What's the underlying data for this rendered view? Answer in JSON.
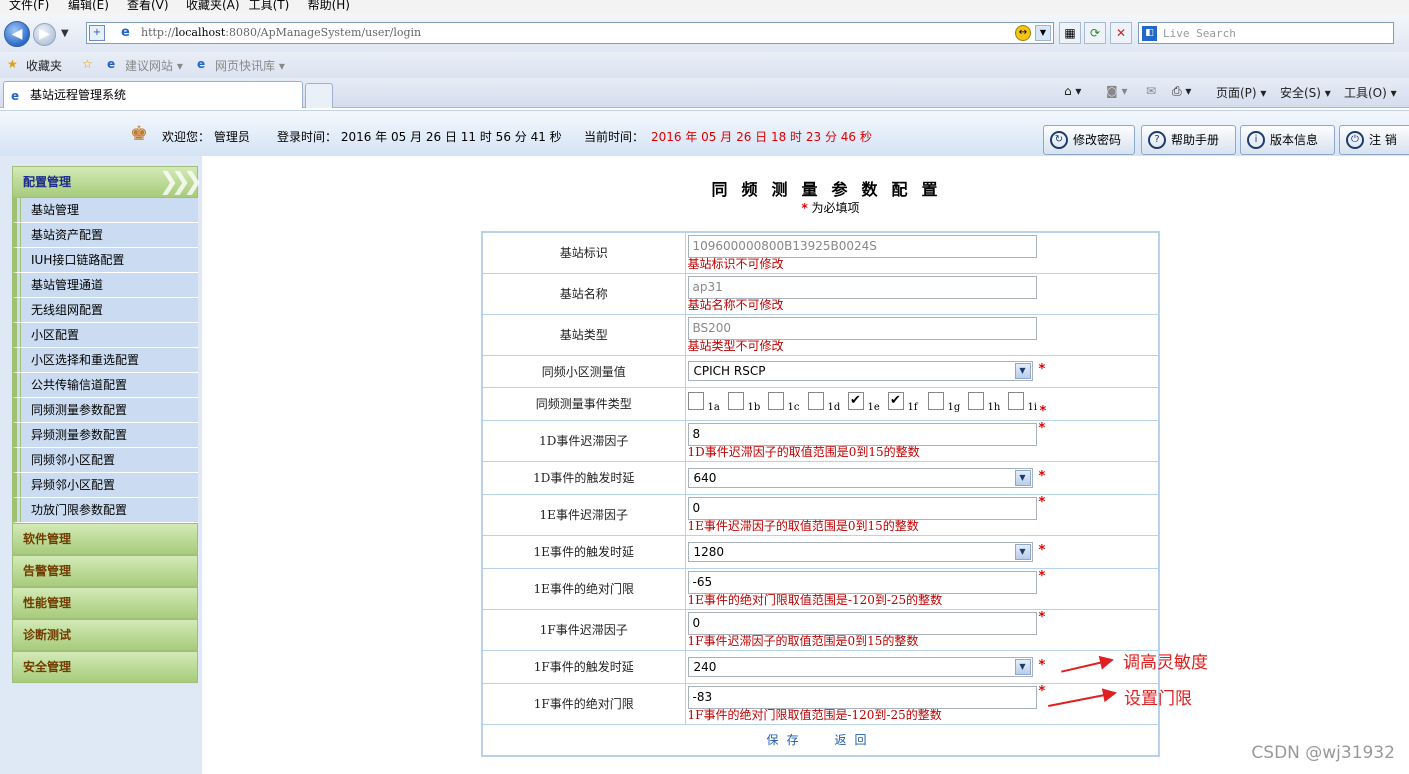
{
  "menu": [
    "文件(F)",
    "编辑(E)",
    "查看(V)",
    "收藏夹(A)",
    "工具(T)",
    "帮助(H)"
  ],
  "address": {
    "prefix": "http://",
    "host": "localhost",
    "rest": ":8080/ApManageSystem/user/login"
  },
  "search": {
    "placeholder": "Live Search"
  },
  "favorites": {
    "label": "收藏夹",
    "suggested": "建议网站 ▾",
    "slices": "网页快讯库 ▾"
  },
  "tab": {
    "title": "基站远程管理系统"
  },
  "commandbar": {
    "page": "页面(P) ▾",
    "safety": "安全(S) ▾",
    "tools": "工具(O) ▾"
  },
  "header": {
    "welcome": "欢迎您： 管理员",
    "login_time": "登录时间： 2016 年 05 月 26 日 11 时 56 分 41 秒",
    "current_label": "当前时间：",
    "current_time": "2016 年 05 月 26 日 18 时 23 分 46 秒",
    "buttons": [
      "修改密码",
      "帮助手册",
      "版本信息",
      "注 销"
    ]
  },
  "sidebar": {
    "active": "配置管理",
    "items": [
      "基站管理",
      "基站资产配置",
      "IUH接口链路配置",
      "基站管理通道",
      "无线组网配置",
      "小区配置",
      "小区选择和重选配置",
      "公共传输信道配置",
      "同频测量参数配置",
      "异频测量参数配置",
      "同频邻小区配置",
      "异频邻小区配置",
      "功放门限参数配置"
    ],
    "sections": [
      "软件管理",
      "告警管理",
      "性能管理",
      "诊断测试",
      "安全管理"
    ]
  },
  "page": {
    "title": "同频测量参数配置",
    "required_star": "*",
    "required_note": "为必填项"
  },
  "form": {
    "bs_id": {
      "label": "基站标识",
      "value": "109600000800B13925B0024S",
      "hint": "基站标识不可修改"
    },
    "bs_name": {
      "label": "基站名称",
      "value": "ap31",
      "hint": "基站名称不可修改"
    },
    "bs_type": {
      "label": "基站类型",
      "value": "BS200",
      "hint": "基站类型不可修改"
    },
    "meas_qty": {
      "label": "同频小区测量值",
      "value": "CPICH RSCP"
    },
    "event_types": {
      "label": "同频测量事件类型",
      "options": [
        "1a",
        "1b",
        "1c",
        "1d",
        "1e",
        "1f",
        "1g",
        "1h",
        "1i"
      ],
      "checked": [
        false,
        false,
        false,
        false,
        true,
        true,
        false,
        false,
        false
      ]
    },
    "hyst_1d": {
      "label": "1D事件迟滞因子",
      "value": "8",
      "hint": "1D事件迟滞因子的取值范围是0到15的整数"
    },
    "ttt_1d": {
      "label": "1D事件的触发时延",
      "value": "640"
    },
    "hyst_1e": {
      "label": "1E事件迟滞因子",
      "value": "0",
      "hint": "1E事件迟滞因子的取值范围是0到15的整数"
    },
    "ttt_1e": {
      "label": "1E事件的触发时延",
      "value": "1280"
    },
    "abs_1e": {
      "label": "1E事件的绝对门限",
      "value": "-65",
      "hint": "1E事件的绝对门限取值范围是-120到-25的整数"
    },
    "hyst_1f": {
      "label": "1F事件迟滞因子",
      "value": "0",
      "hint": "1F事件迟滞因子的取值范围是0到15的整数"
    },
    "ttt_1f": {
      "label": "1F事件的触发时延",
      "value": "240"
    },
    "abs_1f": {
      "label": "1F事件的绝对门限",
      "value": "-83",
      "hint": "1F事件的绝对门限取值范围是-120到-25的整数"
    },
    "save": "保存",
    "back": "返回"
  },
  "annotations": {
    "sensitivity": "调高灵敏度",
    "threshold": "设置门限"
  },
  "watermark": "CSDN @wj31932",
  "colors": {
    "required": "#e00000",
    "hint": "#c00000",
    "annotation": "#e02020",
    "current_time": "#e00000"
  }
}
